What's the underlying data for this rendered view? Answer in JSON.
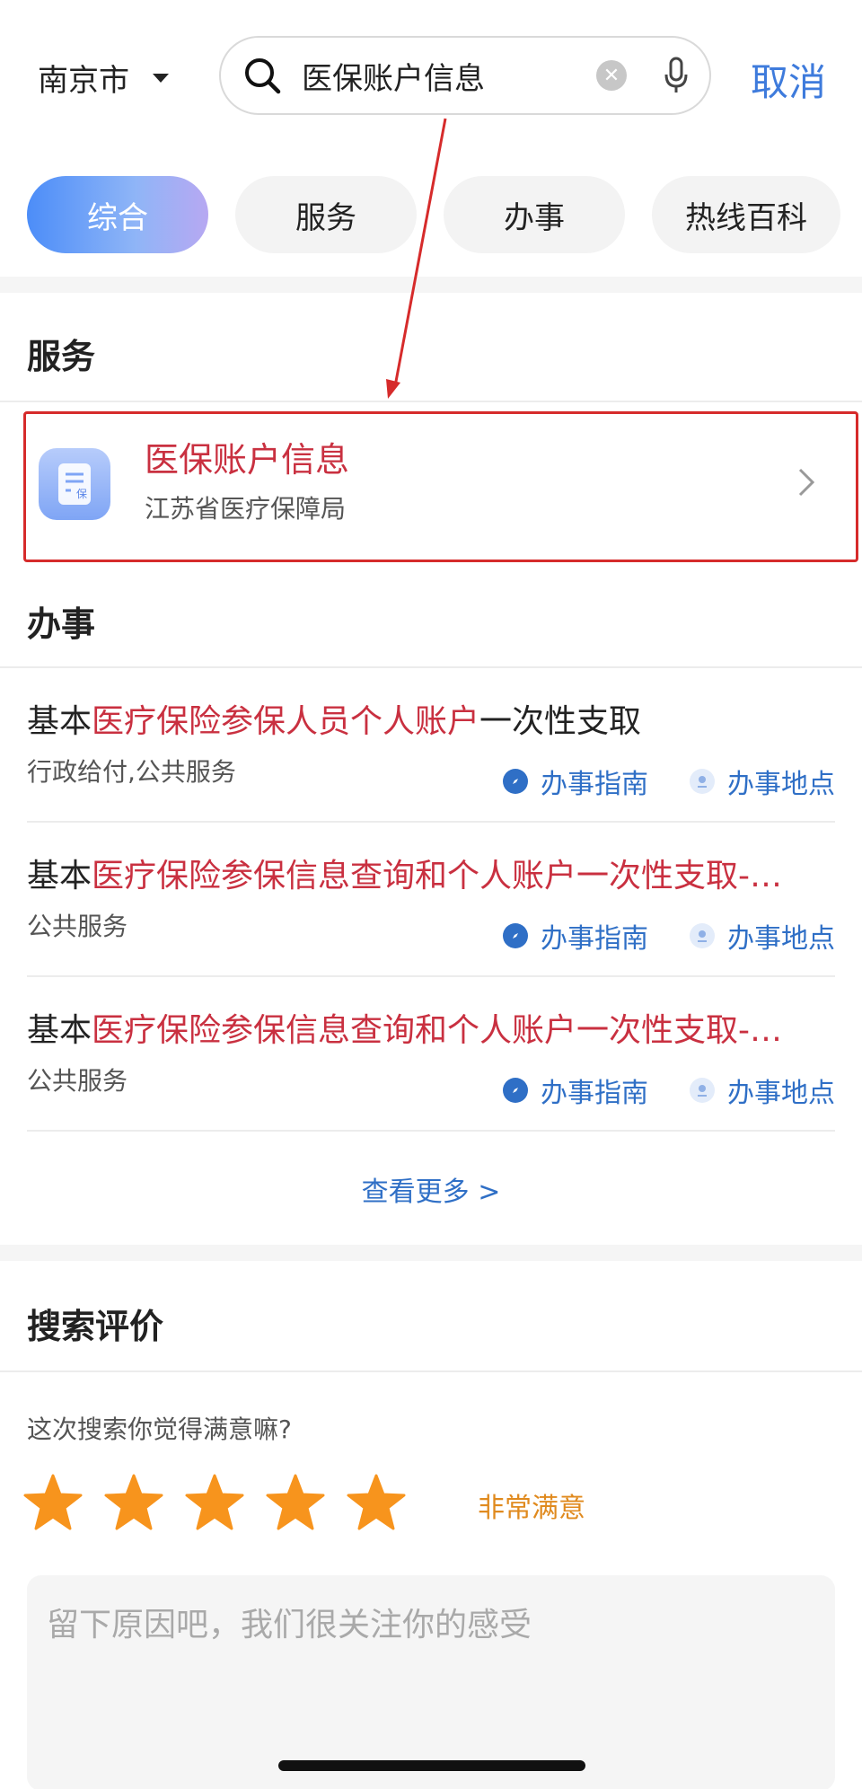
{
  "header": {
    "city": "南京市",
    "search_query": "医保账户信息",
    "cancel_label": "取消"
  },
  "tabs": [
    {
      "label": "综合",
      "active": true
    },
    {
      "label": "服务",
      "active": false
    },
    {
      "label": "办事",
      "active": false
    },
    {
      "label": "热线百科",
      "active": false
    }
  ],
  "service_section": {
    "title": "服务",
    "card": {
      "icon": "document-insurance-icon",
      "icon_glyph": "保",
      "title": "医保账户信息",
      "subtitle": "江苏省医疗保障局"
    }
  },
  "banshi_section": {
    "title": "办事",
    "items": [
      {
        "pre": "基本",
        "highlight": "医疗保险参保人员个人账户",
        "post": "一次性支取",
        "tag": "行政给付,公共服务"
      },
      {
        "pre": "基本",
        "highlight": "医疗保险参保信息查询和个人账户一次性支取-…",
        "post": "",
        "tag": "公共服务"
      },
      {
        "pre": "基本",
        "highlight": "医疗保险参保信息查询和个人账户一次性支取-…",
        "post": "",
        "tag": "公共服务"
      }
    ],
    "guide_label": "办事指南",
    "location_label": "办事地点",
    "more_label": "查看更多 >"
  },
  "evaluation": {
    "title": "搜索评价",
    "question": "这次搜索你觉得满意嘛?",
    "stars": 5,
    "rating_label": "非常满意",
    "feedback_placeholder": "留下原因吧，我们很关注你的感受"
  },
  "colors": {
    "accent": "#3e7bdc",
    "highlight": "#c93040",
    "annotation_red": "#d62b2b",
    "star": "#f7941d"
  }
}
